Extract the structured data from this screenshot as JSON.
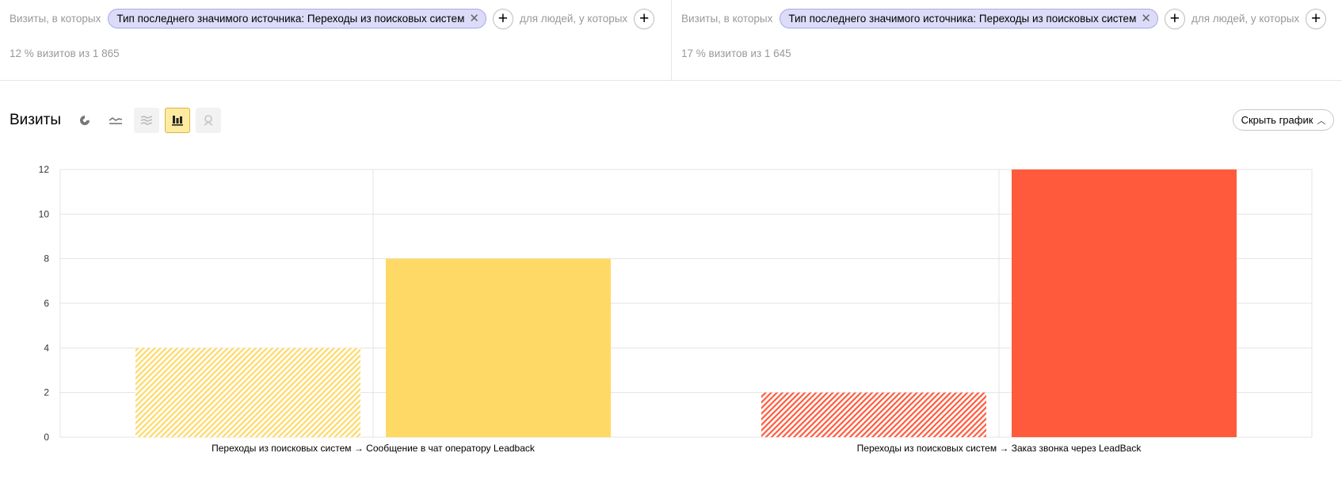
{
  "segments": [
    {
      "prefix": "Визиты, в которых",
      "chip": "Тип последнего значимого источника: Переходы из поисковых систем",
      "suffix": "для людей, у которых",
      "stats": "12 % визитов из 1 865"
    },
    {
      "prefix": "Визиты, в которых",
      "chip": "Тип последнего значимого источника: Переходы из поисковых систем",
      "suffix": "для людей, у которых",
      "stats": "17 % визитов из 1 645"
    }
  ],
  "chart_header": {
    "title": "Визиты",
    "hide_label": "Скрыть график",
    "tools": [
      "pie-chart-icon",
      "line-chart-icon",
      "stacked-area-icon",
      "column-chart-icon",
      "map-pin-icon"
    ],
    "active_tool": "column-chart-icon"
  },
  "colors": {
    "yellow": "#ffd966",
    "red": "#ff5a3c",
    "chip_bg": "#dcdcf9",
    "active_tool_bg": "#ffeba0"
  },
  "chart_data": {
    "type": "bar",
    "categories": [
      "Переходы из поисковых систем → Сообщение в чат оператору Leadback",
      "Переходы из поисковых систем → Заказ звонка через LeadBack"
    ],
    "series": [
      {
        "values": [
          4,
          2
        ],
        "pattern": "hatched"
      },
      {
        "values": [
          8,
          12
        ],
        "pattern": "solid"
      }
    ],
    "category_colors": [
      "#ffd966",
      "#ff5a3c"
    ],
    "ylim": [
      0,
      12
    ],
    "yticks": [
      0,
      2,
      4,
      6,
      8,
      10,
      12
    ],
    "grid": true
  }
}
